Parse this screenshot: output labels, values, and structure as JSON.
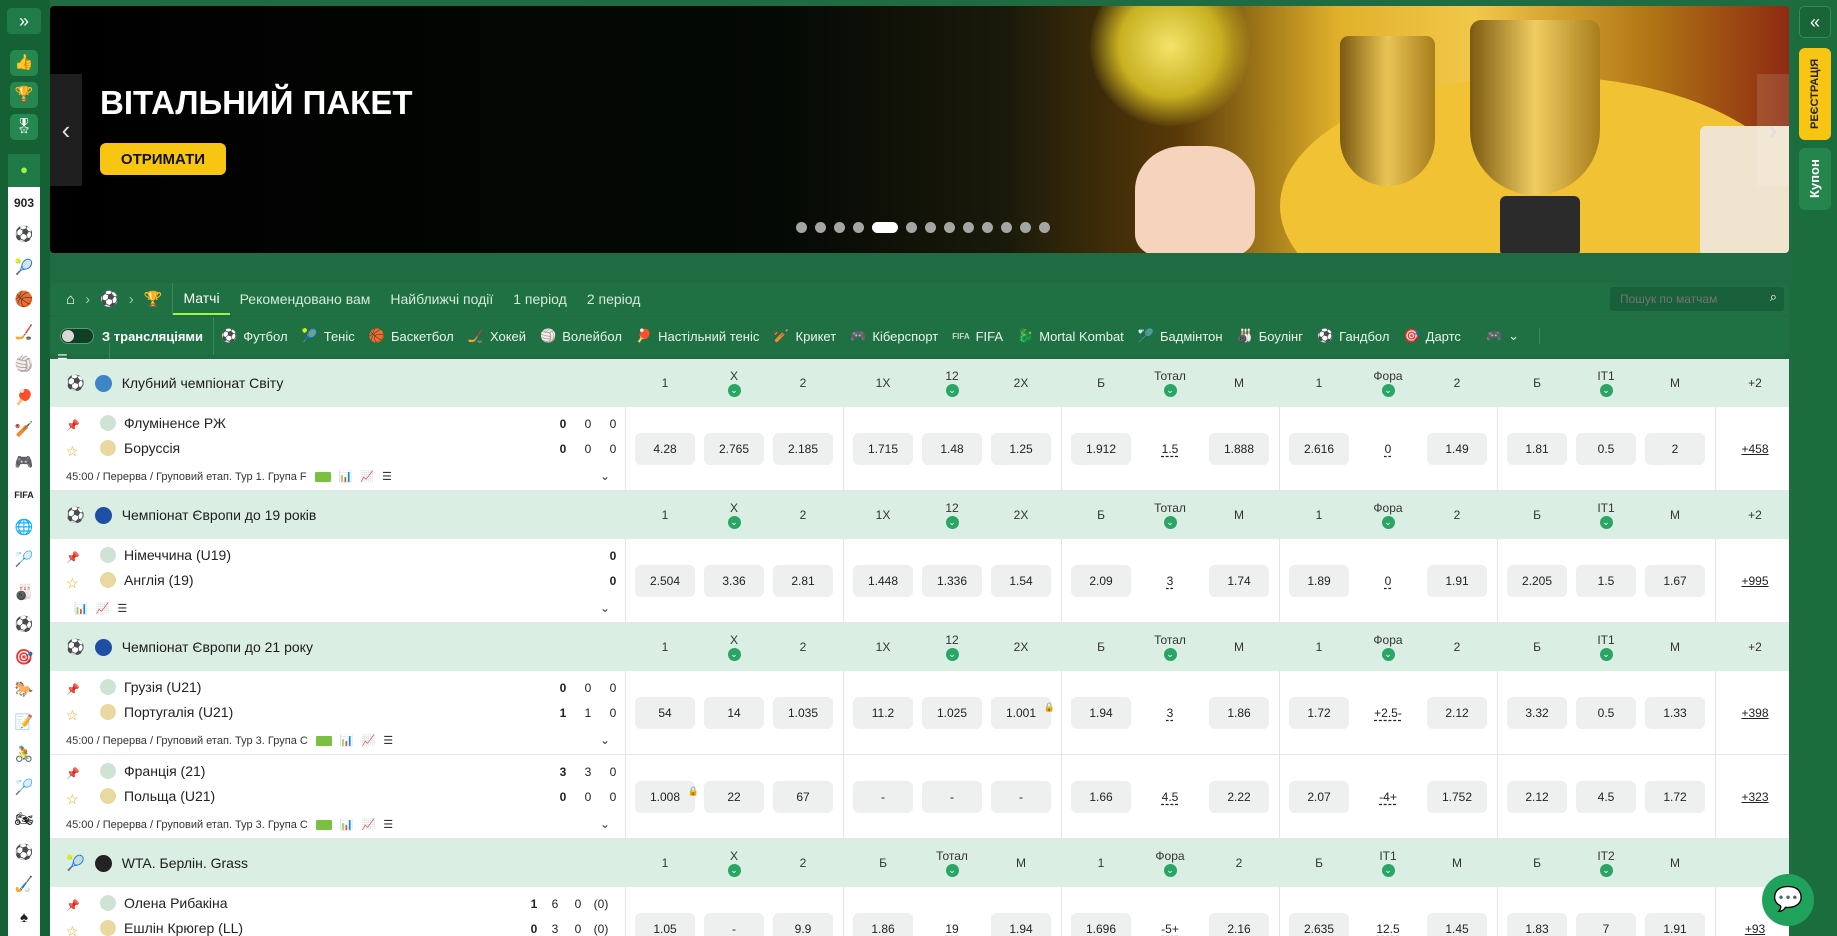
{
  "banner": {
    "title": "ВІТАЛЬНИЙ ПАКЕТ",
    "cta": "ОТРИМАТИ",
    "prev": "‹",
    "next": "›"
  },
  "left_sidebar": {
    "expand": "»",
    "live_count": "903"
  },
  "right_sidebar": {
    "collapse": "«",
    "register": "РЕЄСТРАЦІЯ",
    "coupon": "Купон"
  },
  "nav": {
    "tabs": [
      "Матчі",
      "Рекомендовано вам",
      "Найближчі події",
      "1 період",
      "2 період"
    ],
    "search_placeholder": "Пошук по матчам"
  },
  "filters": {
    "streams_label": "З трансляціями",
    "sports": [
      "Футбол",
      "Теніс",
      "Баскетбол",
      "Хокей",
      "Волейбол",
      "Настільний теніс",
      "Крикет",
      "Кіберспорт",
      "FIFA",
      "Mortal Kombat",
      "Бадмінтон",
      "Боулінг",
      "Гандбол",
      "Дартс"
    ]
  },
  "leagues": [
    {
      "name": "Клубний чемпіонат Світу",
      "flag": "#3d85c6",
      "cols": [
        "1",
        "X",
        "2",
        "1X",
        "12",
        "2X",
        "Б",
        "Тотал",
        "М",
        "1",
        "Фора",
        "2",
        "Б",
        "IT1",
        "М",
        "+2"
      ],
      "matches": [
        {
          "t1": "Флуміненсе РЖ",
          "t2": "Боруссія",
          "s1": [
            "0",
            "0",
            "0"
          ],
          "s2": [
            "0",
            "0",
            "0"
          ],
          "info": "45:00 / Перерва / Груповий етап. Тур 1. Група F",
          "odds": [
            "4.28",
            "2.765",
            "2.185",
            "1.715",
            "1.48",
            "1.25",
            "1.912",
            "1.5",
            "1.888",
            "2.616",
            "0",
            "1.49",
            "1.81",
            "0.5",
            "2"
          ],
          "more": "+458"
        }
      ]
    },
    {
      "name": "Чемпіонат Європи до 19 років",
      "flag": "#1f4fa5",
      "cols": [
        "1",
        "X",
        "2",
        "1X",
        "12",
        "2X",
        "Б",
        "Тотал",
        "М",
        "1",
        "Фора",
        "2",
        "Б",
        "IT1",
        "М",
        "+2"
      ],
      "matches": [
        {
          "t1": "Німеччина (U19)",
          "t2": "Англія (19)",
          "s1": [
            "",
            "",
            "0"
          ],
          "s2": [
            "",
            "",
            "0"
          ],
          "info": "",
          "odds": [
            "2.504",
            "3.36",
            "2.81",
            "1.448",
            "1.336",
            "1.54",
            "2.09",
            "3",
            "1.74",
            "1.89",
            "0",
            "1.91",
            "2.205",
            "1.5",
            "1.67"
          ],
          "more": "+995"
        }
      ]
    },
    {
      "name": "Чемпіонат Європи до 21 року",
      "flag": "#1f4fa5",
      "cols": [
        "1",
        "X",
        "2",
        "1X",
        "12",
        "2X",
        "Б",
        "Тотал",
        "М",
        "1",
        "Фора",
        "2",
        "Б",
        "IT1",
        "М",
        "+2"
      ],
      "matches": [
        {
          "t1": "Грузія (U21)",
          "t2": "Португалія (U21)",
          "s1": [
            "0",
            "0",
            "0"
          ],
          "s2": [
            "1",
            "1",
            "0"
          ],
          "info": "45:00 / Перерва / Груповий етап. Тур 3. Група С",
          "odds": [
            "54",
            "14",
            "1.035",
            "11.2",
            "1.025",
            "1.001",
            "1.94",
            "3",
            "1.86",
            "1.72",
            "+2.5-",
            "2.12",
            "3.32",
            "0.5",
            "1.33"
          ],
          "more": "+398"
        },
        {
          "t1": "Франція (21)",
          "t2": "Польща (U21)",
          "s1": [
            "3",
            "3",
            "0"
          ],
          "s2": [
            "0",
            "0",
            "0"
          ],
          "info": "45:00 / Перерва / Груповий етап. Тур 3. Група С",
          "odds": [
            "1.008",
            "22",
            "67",
            "-",
            "-",
            "-",
            "1.66",
            "4.5",
            "2.22",
            "2.07",
            "-4+",
            "1.752",
            "2.12",
            "4.5",
            "1.72"
          ],
          "more": "+323"
        }
      ]
    },
    {
      "name": "WTA. Берлін. Grass",
      "flag": "#222",
      "cols": [
        "1",
        "X",
        "2",
        "Б",
        "Тотал",
        "М",
        "1",
        "Фора",
        "2",
        "Б",
        "IT1",
        "М",
        "Б",
        "IT2",
        "М",
        ""
      ],
      "matches": [
        {
          "t1": "Олена Рибакіна",
          "t2": "Ешлін Крюгер (LL)",
          "s1": [
            "1",
            "6",
            "0",
            "(0)"
          ],
          "s2": [
            "0",
            "3",
            "0",
            "(0)"
          ],
          "info": "",
          "odds": [
            "1.05",
            "-",
            "9.9",
            "1.86",
            "19",
            "1.94",
            "1.696",
            "-5+",
            "2.16",
            "2.635",
            "12.5",
            "1.45",
            "1.83",
            "7",
            "1.91"
          ],
          "more": "+93"
        }
      ]
    }
  ],
  "colors": {
    "brand": "#1f7143",
    "accent": "#f9c513",
    "live": "#9bf542",
    "league_bg": "#dbeee3"
  }
}
